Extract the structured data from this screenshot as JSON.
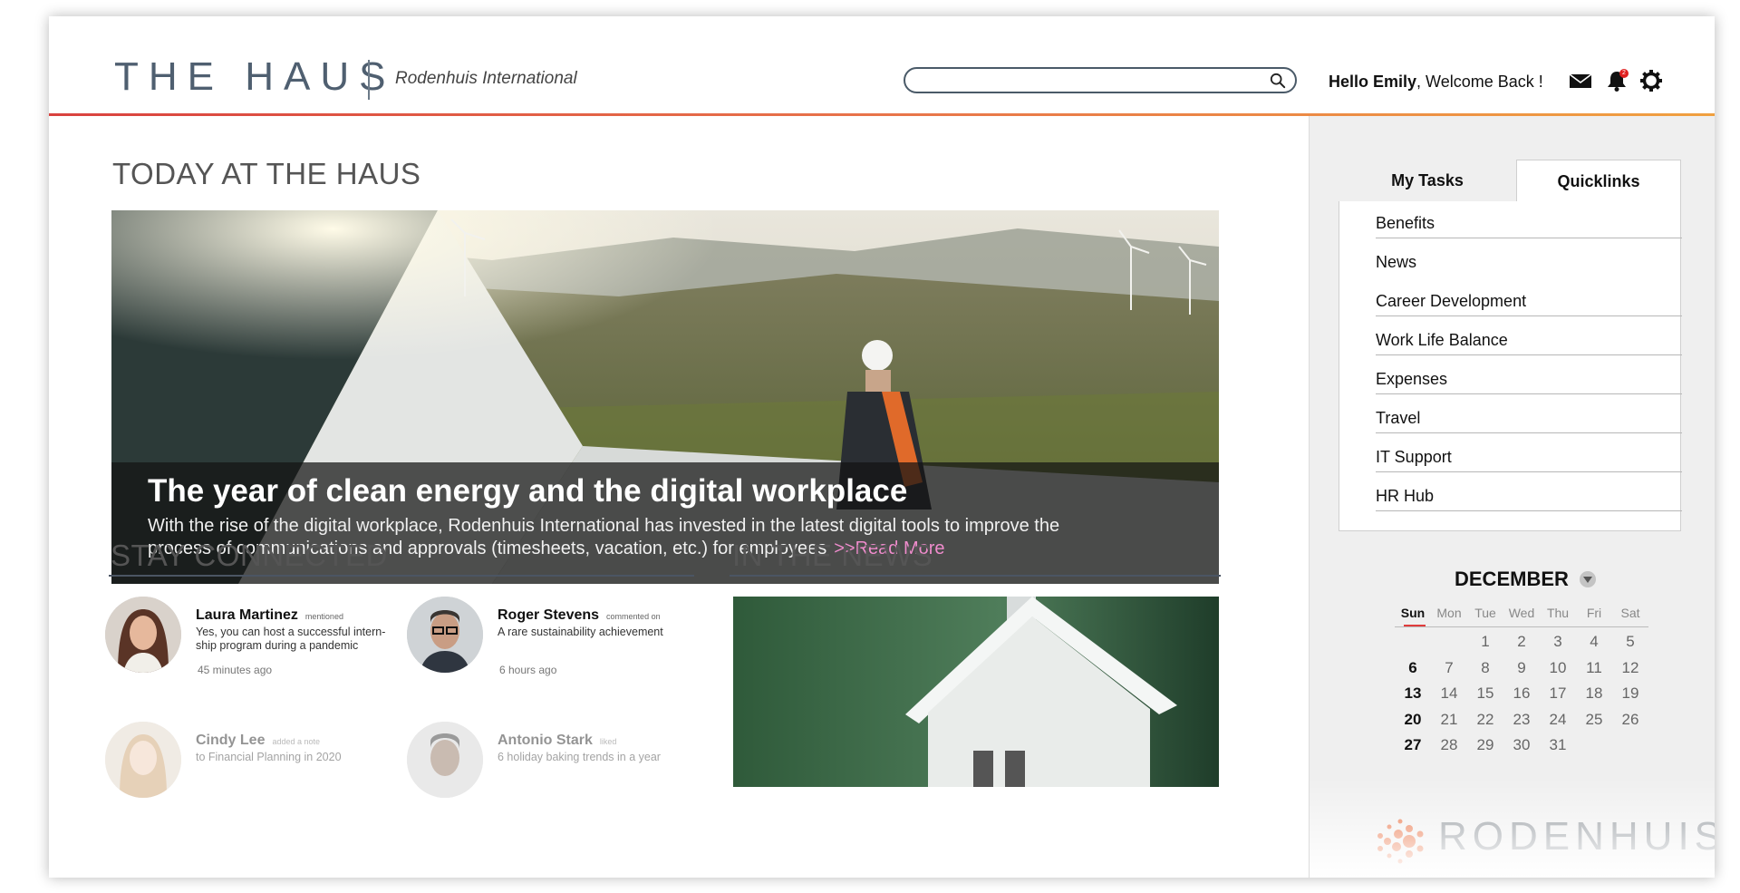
{
  "header": {
    "logo_text": "THE HAUS",
    "org_name": "Rodenhuis International",
    "search_value": "",
    "greeting_name": "Hello Emily",
    "greeting_rest": ", Welcome Back !",
    "notification_count": "2",
    "icons": [
      "search-icon",
      "mail-icon",
      "bell-icon",
      "gear-icon"
    ]
  },
  "main": {
    "today_title": "TODAY AT THE HAUS",
    "hero": {
      "headline": "The year of clean energy and the digital workplace",
      "body": "With the rise of the digital workplace, Rodenhuis International has invested in the latest digital tools to improve the process of communications and approvals (timesheets, vacation, etc.) for employees",
      "read_more": ">>Read More"
    },
    "stay_connected_title": "STAY CONNECTED",
    "in_the_news_title": "IN THE NEWS",
    "activity": [
      {
        "name": "Laura Martinez",
        "action": "mentioned",
        "message": "Yes, you can host a successful intern-ship program during a pandemic",
        "time": "45 minutes ago"
      },
      {
        "name": "Roger Stevens",
        "action": "commented on",
        "message": "A rare sustainability achievement",
        "time": "6 hours ago"
      },
      {
        "name": "Cindy Lee",
        "action": "added a note",
        "message": "to Financial Planning in 2020",
        "time": ""
      },
      {
        "name": "Antonio Stark",
        "action": "liked",
        "message": "6 holiday baking trends in a year",
        "time": ""
      }
    ]
  },
  "sidebar": {
    "tabs": [
      {
        "label": "My Tasks",
        "active": false
      },
      {
        "label": "Quicklinks",
        "active": true
      }
    ],
    "quicklinks": [
      "Benefits",
      "News",
      "Career Development",
      "Work Life Balance",
      "Expenses",
      "Travel",
      "IT Support",
      "HR Hub"
    ],
    "calendar": {
      "month": "DECEMBER",
      "weekdays": [
        "Sun",
        "Mon",
        "Tue",
        "Wed",
        "Thu",
        "Fri",
        "Sat"
      ],
      "weeks": [
        [
          "",
          "",
          "1",
          "2",
          "3",
          "4",
          "5"
        ],
        [
          "6",
          "7",
          "8",
          "9",
          "10",
          "11",
          "12"
        ],
        [
          "13",
          "14",
          "15",
          "16",
          "17",
          "18",
          "19"
        ],
        [
          "20",
          "21",
          "22",
          "23",
          "24",
          "25",
          "26"
        ],
        [
          "27",
          "28",
          "29",
          "30",
          "31",
          "",
          ""
        ]
      ]
    },
    "brand_text": "RODENHUIS"
  },
  "colors": {
    "header_rule_start": "#d9423f",
    "header_rule_end": "#f0a040",
    "read_more": "#f08ccd",
    "logo": "#4f5f70",
    "badge": "#e02020",
    "sunday_underline": "#e03c3c"
  }
}
